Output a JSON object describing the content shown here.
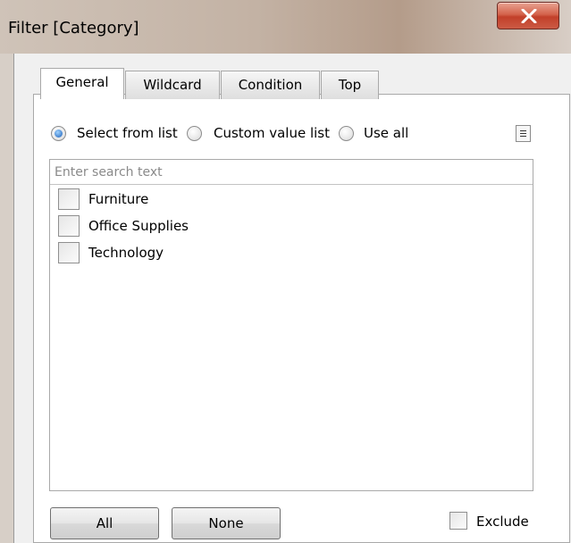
{
  "window": {
    "title": "Filter [Category]"
  },
  "tabs": [
    {
      "label": "General",
      "active": true
    },
    {
      "label": "Wildcard",
      "active": false
    },
    {
      "label": "Condition",
      "active": false
    },
    {
      "label": "Top",
      "active": false
    }
  ],
  "selection_mode": {
    "options": [
      {
        "label": "Select from list",
        "checked": true
      },
      {
        "label": "Custom value list",
        "checked": false
      },
      {
        "label": "Use all",
        "checked": false
      }
    ]
  },
  "list": {
    "search_placeholder": "Enter search text",
    "items": [
      {
        "label": "Furniture",
        "checked": false
      },
      {
        "label": "Office Supplies",
        "checked": false
      },
      {
        "label": "Technology",
        "checked": false
      }
    ]
  },
  "footer": {
    "all_label": "All",
    "none_label": "None",
    "exclude_label": "Exclude",
    "exclude_checked": false
  },
  "icons": {
    "close": "close-icon",
    "menu": "list-menu-icon"
  },
  "colors": {
    "close_button": "#c94a33",
    "radio_selected": "#1b5fb8"
  }
}
